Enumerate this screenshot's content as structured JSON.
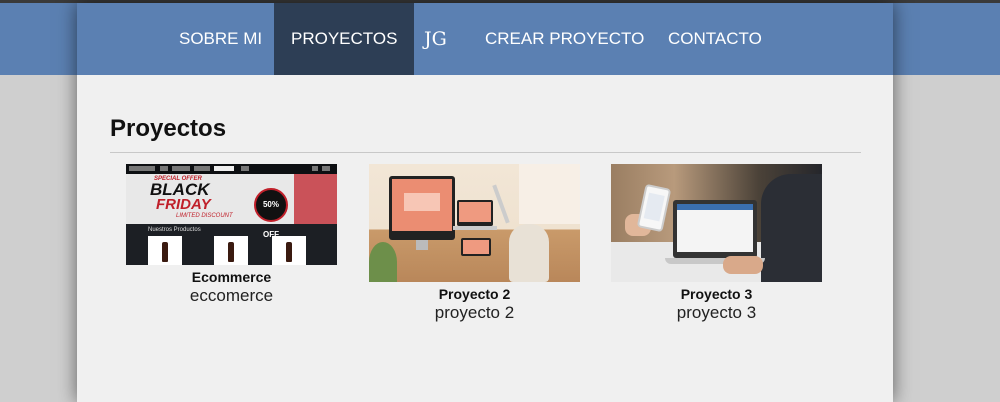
{
  "nav": {
    "items": [
      {
        "label": "SOBRE MI"
      },
      {
        "label": "PROYECTOS",
        "active": true
      },
      {
        "label": "JG"
      },
      {
        "label": "CREAR PROYECTO"
      },
      {
        "label": "CONTACTO"
      }
    ]
  },
  "main": {
    "title": "Proyectos",
    "projects": [
      {
        "name": "Ecommerce",
        "description": "eccomerce"
      },
      {
        "name": "Proyecto 2",
        "description": "proyecto 2"
      },
      {
        "name": "Proyecto 3",
        "description": "proyecto 3"
      }
    ]
  },
  "thumb1": {
    "banner_top": "SPECIAL OFFER",
    "banner_black": "BLACK",
    "banner_friday": "FRIDAY",
    "banner_bottom": "LIMITED DISCOUNT",
    "badge": "50% OFF",
    "section": "Nuestros Productos"
  },
  "colors": {
    "nav_background": "#5b80b2",
    "nav_active": "#2d3e55",
    "page_background": "#f0f0f0",
    "outer_background": "#cfcfcf"
  }
}
